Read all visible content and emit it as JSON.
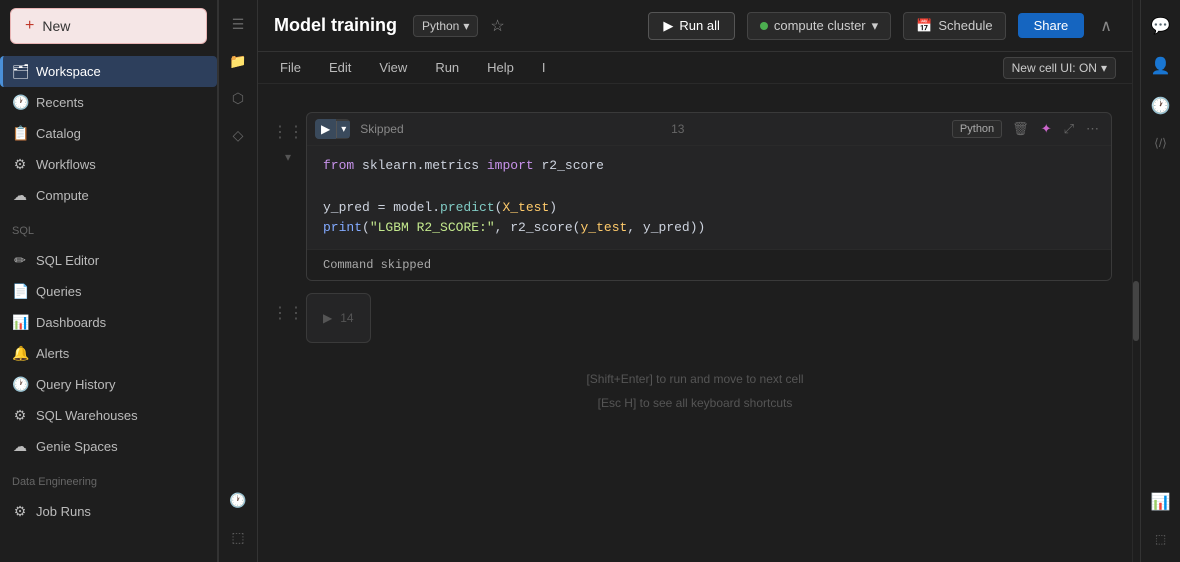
{
  "new_button": {
    "label": "New",
    "plus": "+"
  },
  "sidebar": {
    "items": [
      {
        "id": "workspace",
        "label": "Workspace",
        "icon": "🗂",
        "active": true
      },
      {
        "id": "recents",
        "label": "Recents",
        "icon": "🕐",
        "active": false
      },
      {
        "id": "catalog",
        "label": "Catalog",
        "icon": "📋",
        "active": false
      },
      {
        "id": "workflows",
        "label": "Workflows",
        "icon": "⚙",
        "active": false
      },
      {
        "id": "compute",
        "label": "Compute",
        "icon": "☁",
        "active": false
      }
    ],
    "sql_section": "SQL",
    "sql_items": [
      {
        "id": "sql-editor",
        "label": "SQL Editor",
        "icon": "✏"
      },
      {
        "id": "queries",
        "label": "Queries",
        "icon": "📄"
      },
      {
        "id": "dashboards",
        "label": "Dashboards",
        "icon": "📊"
      },
      {
        "id": "alerts",
        "label": "Alerts",
        "icon": "🔔"
      },
      {
        "id": "query-history",
        "label": "Query History",
        "icon": "🕐"
      },
      {
        "id": "sql-warehouses",
        "label": "SQL Warehouses",
        "icon": "⚙"
      },
      {
        "id": "genie-spaces",
        "label": "Genie Spaces",
        "icon": "☁"
      }
    ],
    "data_engineering_section": "Data Engineering",
    "data_engineering_items": [
      {
        "id": "job-runs",
        "label": "Job Runs",
        "icon": "⚙"
      }
    ]
  },
  "topbar": {
    "title": "Model training",
    "language": "Python",
    "language_chevron": "▾",
    "star_label": "☆",
    "run_all_label": "Run all",
    "run_icon": "▶",
    "compute_cluster_label": "compute cluster",
    "compute_chevron": "▾",
    "schedule_label": "Schedule",
    "calendar_icon": "📅",
    "share_label": "Share",
    "collapse_icon": "∧"
  },
  "menubar": {
    "items": [
      "File",
      "Edit",
      "View",
      "Run",
      "Help",
      "I"
    ],
    "new_cell_ui": "New cell UI: ON",
    "new_cell_chevron": "▾"
  },
  "cells": [
    {
      "id": "cell-13",
      "number": "13",
      "status": "Skipped",
      "language": "Python",
      "lines": [
        {
          "parts": [
            {
              "type": "kw",
              "text": "from"
            },
            {
              "type": "plain",
              "text": " sklearn.metrics "
            },
            {
              "type": "kw",
              "text": "import"
            },
            {
              "type": "plain",
              "text": " r2_score"
            }
          ]
        },
        {
          "parts": []
        },
        {
          "parts": [
            {
              "type": "plain",
              "text": "y_pred = model."
            },
            {
              "type": "method",
              "text": "predict"
            },
            {
              "type": "plain",
              "text": "("
            },
            {
              "type": "param",
              "text": "X_test"
            },
            {
              "type": "plain",
              "text": ")"
            }
          ]
        },
        {
          "parts": [
            {
              "type": "fn",
              "text": "print"
            },
            {
              "type": "plain",
              "text": "("
            },
            {
              "type": "str",
              "text": "\"LGBM R2_SCORE:\""
            },
            {
              "type": "plain",
              "text": ", r2_score("
            },
            {
              "type": "param",
              "text": "y_test"
            },
            {
              "type": "plain",
              "text": ", y_pred))"
            }
          ]
        }
      ],
      "output": "Command skipped"
    },
    {
      "id": "cell-14",
      "number": "14",
      "empty": true
    }
  ],
  "hints": [
    "[Shift+Enter] to run and move to next cell",
    "[Esc H] to see all keyboard shortcuts"
  ],
  "right_sidebar": {
    "icons": [
      "💬",
      "👤",
      "🕐",
      "⟨/⟩",
      "📊"
    ]
  }
}
